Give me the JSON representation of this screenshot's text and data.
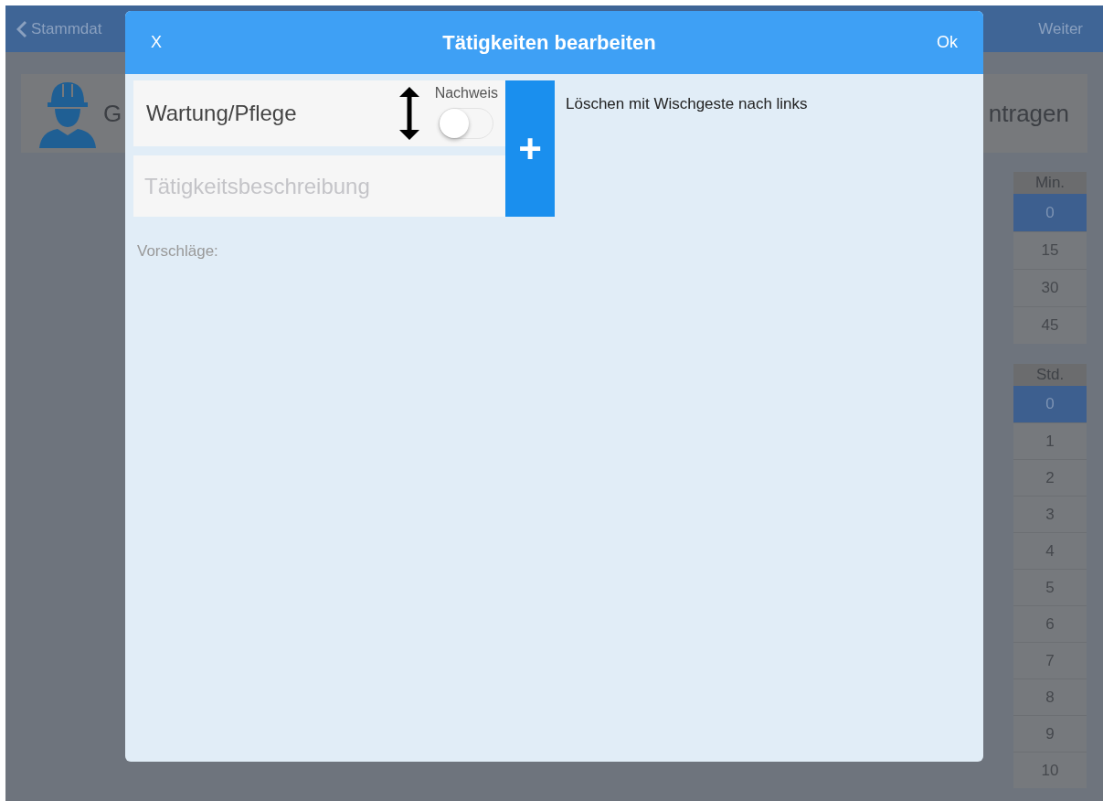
{
  "background": {
    "nav": {
      "back_label": "Stammdat",
      "next_label": "Weiter"
    },
    "card": {
      "label_start": "G",
      "label_end": "ntragen"
    },
    "minutes": {
      "header": "Min.",
      "items": [
        {
          "label": "0",
          "selected": true
        },
        {
          "label": "15",
          "selected": false
        },
        {
          "label": "30",
          "selected": false
        },
        {
          "label": "45",
          "selected": false
        }
      ]
    },
    "hours": {
      "header": "Std.",
      "items": [
        {
          "label": "0",
          "selected": true
        },
        {
          "label": "1",
          "selected": false
        },
        {
          "label": "2",
          "selected": false
        },
        {
          "label": "3",
          "selected": false
        },
        {
          "label": "4",
          "selected": false
        },
        {
          "label": "5",
          "selected": false
        },
        {
          "label": "6",
          "selected": false
        },
        {
          "label": "7",
          "selected": false
        },
        {
          "label": "8",
          "selected": false
        },
        {
          "label": "9",
          "selected": false
        },
        {
          "label": "10",
          "selected": false
        }
      ]
    }
  },
  "dialog": {
    "close_label": "X",
    "title": "Tätigkeiten bearbeiten",
    "ok_label": "Ok",
    "activity": {
      "value": "Wartung/Pflege",
      "toggle_label": "Nachweis",
      "on": false
    },
    "description": {
      "placeholder": "Tätigkeitsbeschreibung"
    },
    "add_label": "+",
    "hint": "Löschen mit Wischgeste nach links",
    "suggestions_label": "Vorschläge:"
  }
}
